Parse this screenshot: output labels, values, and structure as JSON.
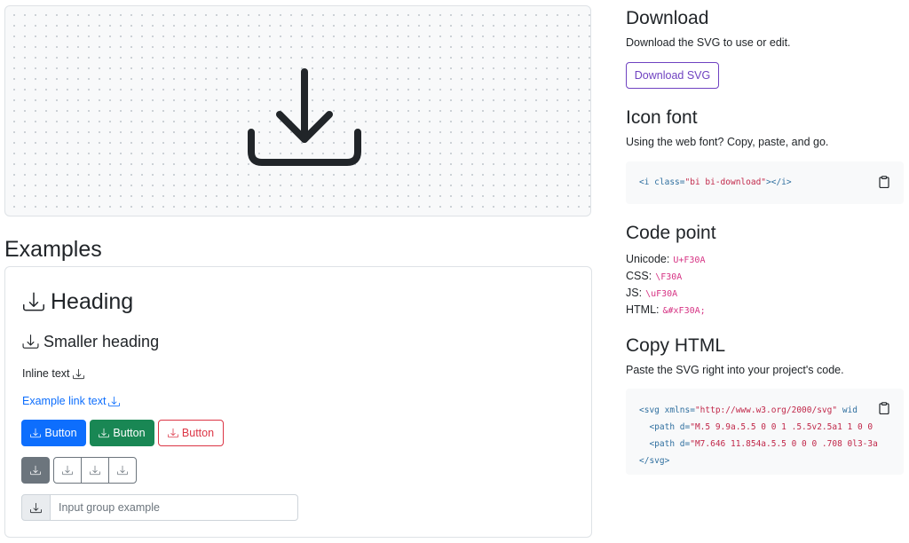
{
  "examples_section": {
    "title": "Examples",
    "heading": "Heading",
    "smaller_heading": "Smaller heading",
    "inline_text": "Inline text",
    "link_text": "Example link text",
    "buttons": {
      "primary": "Button",
      "success": "Button",
      "outline_danger": "Button"
    },
    "input_placeholder": "Input group example"
  },
  "download": {
    "title": "Download",
    "description": "Download the SVG to use or edit.",
    "button": "Download SVG"
  },
  "icon_font": {
    "title": "Icon font",
    "description": "Using the web font? Copy, paste, and go.",
    "code": {
      "open": "<i ",
      "attr": "class=",
      "value": "\"bi bi-download\"",
      "close": "></i>"
    }
  },
  "code_point": {
    "title": "Code point",
    "rows": [
      {
        "label": "Unicode:",
        "value": "U+F30A"
      },
      {
        "label": "CSS:",
        "value": "\\F30A"
      },
      {
        "label": "JS:",
        "value": "\\uF30A"
      },
      {
        "label": "HTML:",
        "value": "&#xF30A;"
      }
    ]
  },
  "copy_html": {
    "title": "Copy HTML",
    "description": "Paste the SVG right into your project's code.",
    "code": {
      "l1_tag": "<svg ",
      "l1_attr": "xmlns=",
      "l1_val": "\"http://www.w3.org/2000/svg\"",
      "l1_rest": " wid",
      "l2_tag": "  <path ",
      "l2_attr": "d=",
      "l2_val": "\"M.5 9.9a.5.5 0 0 1 .5.5v2.5a1 1 0 0",
      "l3_tag": "  <path ",
      "l3_attr": "d=",
      "l3_val": "\"M7.646 11.854a.5.5 0 0 0 .708 0l3-3a",
      "l4_tag": "</svg>"
    }
  },
  "icons": {
    "main": "download-icon",
    "clipboard": "clipboard-icon"
  },
  "colors": {
    "primary": "#0d6efd",
    "success": "#198754",
    "danger": "#dc3545",
    "secondary": "#6c757d",
    "purple": "#6f42c1",
    "code_string": "#c1284a",
    "code_pink": "#d63384"
  }
}
